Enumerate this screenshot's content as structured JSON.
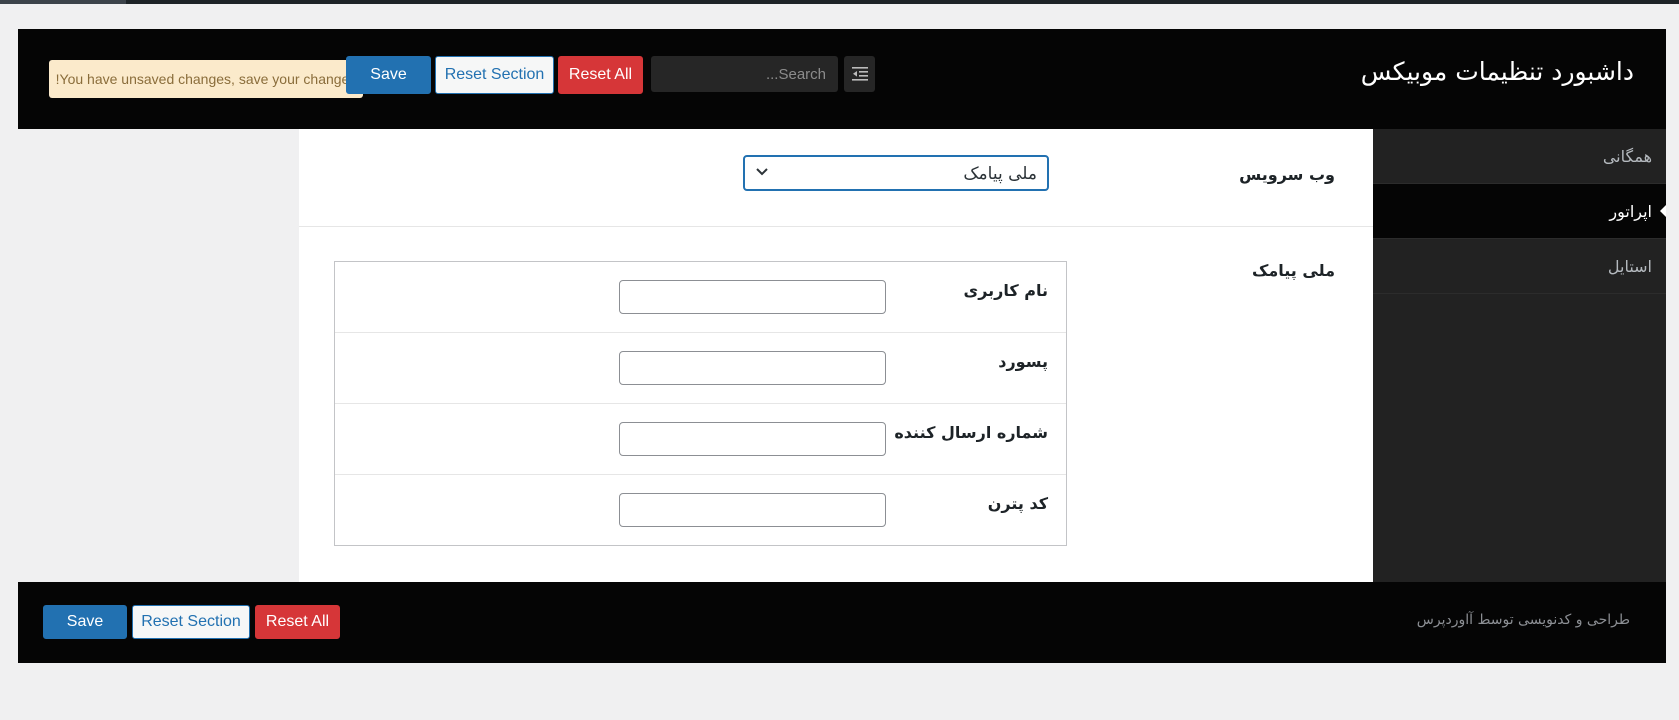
{
  "header": {
    "title": "داشبورد تنظیمات موبیکس",
    "notice": "!You have unsaved changes, save your changes",
    "save_label": "Save",
    "reset_section_label": "Reset Section",
    "reset_all_label": "Reset All",
    "search_placeholder": "...Search"
  },
  "sidebar": {
    "items": [
      {
        "label": "همگانی",
        "active": false
      },
      {
        "label": "اپراتور",
        "active": true
      },
      {
        "label": "استایل",
        "active": false
      }
    ]
  },
  "main": {
    "webservice": {
      "label": "وب سرویس",
      "selected": "ملی پیامک"
    },
    "group": {
      "label": "ملی پیامک",
      "fields": [
        {
          "label": "نام کاربری",
          "value": ""
        },
        {
          "label": "پسورد",
          "value": ""
        },
        {
          "label": "شماره ارسال کننده",
          "value": ""
        },
        {
          "label": "کد پترن",
          "value": ""
        }
      ]
    }
  },
  "footer": {
    "save_label": "Save",
    "reset_section_label": "Reset Section",
    "reset_all_label": "Reset All",
    "credit": "طراحی و کدنویسی توسط آاوردپرس"
  },
  "colors": {
    "primary": "#2271b1",
    "danger": "#d63638",
    "notice_bg": "#fbeacb",
    "header_bg": "#050505",
    "sidebar_bg": "#222222"
  },
  "icons": {
    "expand": "indent-list-icon",
    "select_arrow": "chevron-down-icon",
    "active_marker": "caret-left-icon"
  }
}
